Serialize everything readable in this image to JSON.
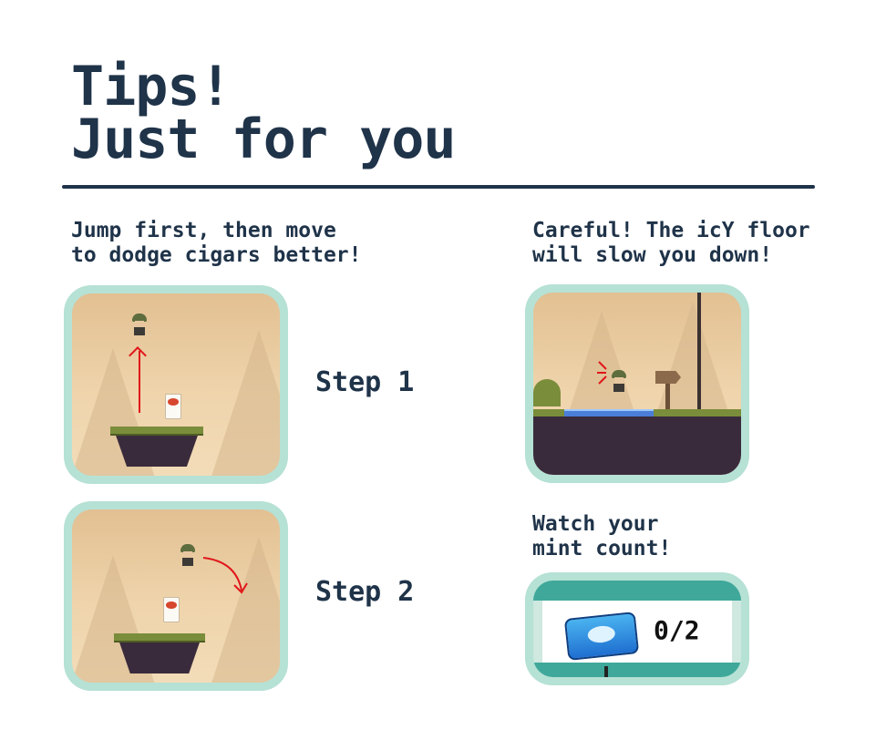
{
  "title": {
    "line1": "Tips!",
    "line2": "Just for you"
  },
  "tips": {
    "jump": {
      "line1": "Jump first, then move",
      "line2": "to dodge cigars better!"
    },
    "ice": {
      "line1": "Careful! The icY floor",
      "line2": "will slow you down!"
    },
    "mint": {
      "line1": "Watch your",
      "line2": "mint count!"
    }
  },
  "steps": {
    "step1": "Step 1",
    "step2": "Step 2"
  },
  "hud": {
    "mint_count": "0/2"
  },
  "colors": {
    "text": "#1f3349",
    "frame": "#b6e1d5",
    "arrow": "#e0161a",
    "hud_teal": "#3fa89a"
  }
}
